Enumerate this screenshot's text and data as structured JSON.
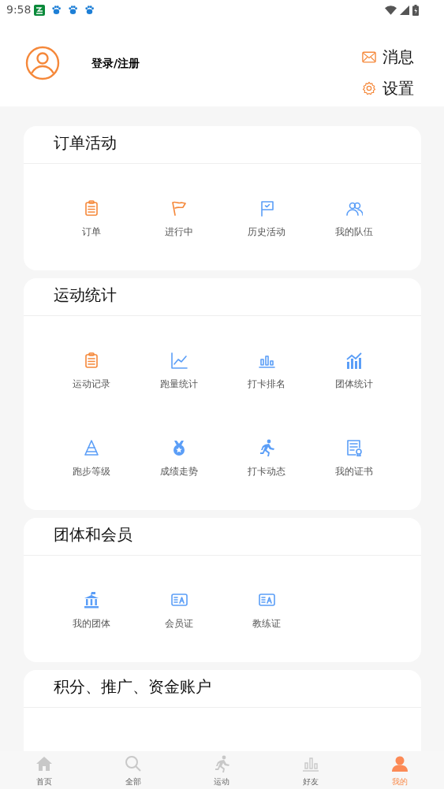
{
  "status_bar": {
    "time": "9:58"
  },
  "header": {
    "login_label": "登录/注册",
    "actions": [
      "消息",
      "设置"
    ]
  },
  "sections": [
    {
      "title": "订单活动",
      "items": [
        "订单",
        "进行中",
        "历史活动",
        "我的队伍"
      ]
    },
    {
      "title": "运动统计",
      "items": [
        "运动记录",
        "跑量统计",
        "打卡排名",
        "团体统计",
        "跑步等级",
        "成绩走势",
        "打卡动态",
        "我的证书"
      ]
    },
    {
      "title": "团体和会员",
      "items": [
        "我的团体",
        "会员证",
        "教练证"
      ]
    },
    {
      "title": "积分、推广、资金账户"
    }
  ],
  "tab_bar": [
    {
      "label": "首页",
      "selected": false
    },
    {
      "label": "全部",
      "selected": false
    },
    {
      "label": "运动",
      "selected": false
    },
    {
      "label": "好友",
      "selected": false
    },
    {
      "label": "我的",
      "selected": true
    }
  ]
}
